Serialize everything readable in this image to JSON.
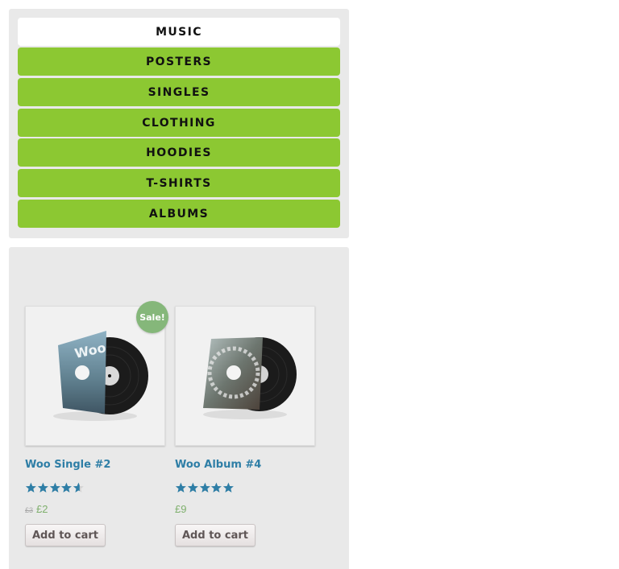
{
  "categories": {
    "items": [
      {
        "label": "Music",
        "active": true
      },
      {
        "label": "Posters"
      },
      {
        "label": "Singles"
      },
      {
        "label": "Clothing"
      },
      {
        "label": "Hoodies"
      },
      {
        "label": "T-Shirts"
      },
      {
        "label": "Albums"
      }
    ]
  },
  "products": [
    {
      "title": "Woo Single #2",
      "badge": "Sale!",
      "rating": 4.6,
      "old_price": "£3",
      "price": "£2",
      "button": "Add to cart",
      "image_icon": "vinyl-single-cover-icon",
      "cover_text": "Woo"
    },
    {
      "title": "Woo Album #4",
      "rating": 5,
      "price": "£9",
      "button": "Add to cart",
      "image_icon": "vinyl-album-cover-icon"
    }
  ],
  "colors": {
    "category_bg": "#8cc832",
    "link": "#2e7ea6",
    "price": "#7fb06d",
    "sale_badge": "#85b77a",
    "star": "#2e7ea6"
  }
}
